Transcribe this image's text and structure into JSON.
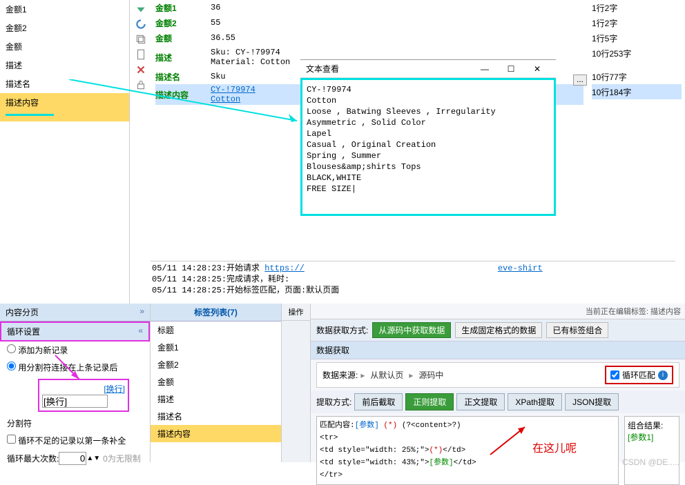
{
  "left_items": [
    "金额1",
    "金额2",
    "金额",
    "描述",
    "描述名",
    "描述内容"
  ],
  "left_selected_index": 5,
  "middle_rows": [
    {
      "label": "金额1",
      "val": "36",
      "stat": "1行2字"
    },
    {
      "label": "金额2",
      "val": "55",
      "stat": "1行2字"
    },
    {
      "label": "金额",
      "val": "36.55",
      "stat": "1行5字"
    },
    {
      "label": "描述",
      "val": "Sku: CY-!79974\nMaterial: Cotton",
      "stat": "10行253字"
    },
    {
      "label": "描述名",
      "val": "Sku",
      "stat": "10行77字"
    },
    {
      "label": "描述内容",
      "val": "CY-!79974\nCotton",
      "stat": "10行184字",
      "highlight": true
    }
  ],
  "popup": {
    "title": "文本查看",
    "body": "CY-!79974\nCotton\nLoose , Batwing Sleeves , Irregularity\nAsymmetric , Solid Color\nLapel\nCasual , Original Creation\nSpring , Summer\nBlouses&amp;shirts Tops\nBLACK,WHITE\nFREE SIZE|"
  },
  "logs": [
    {
      "t": "05/11 14:28:23:开始请求 ",
      "link": "https://",
      "tail": "eve-shirt"
    },
    {
      "t": "05/11 14:28:25:完成请求，耗时:"
    },
    {
      "t": "05/11 14:28:25:开始标签匹配，页面:默认页面"
    }
  ],
  "bl": {
    "hdr1": "内容分页",
    "hdr2": "循环设置",
    "radio1": "添加为新记录",
    "radio2": "用分割符连接在上条记录后",
    "swap": "[换行]",
    "sep_label": "分割符",
    "sep_value": "[换行]",
    "chk": "循环不足的记录以第一条补全",
    "maxlabel": "循环最大次数:",
    "maxval": "0",
    "maxnote": "0为无限制"
  },
  "taglist": {
    "header": "标签列表(7)",
    "items": [
      "标题",
      "金额1",
      "金额2",
      "金额",
      "描述",
      "描述名",
      "描述内容"
    ],
    "sel": 6
  },
  "ops_header": "操作",
  "rm": {
    "topnote": "当前正在编辑标签:  描述内容",
    "acq_label": "数据获取方式:",
    "btn_src": "从源码中获取数据",
    "btn_fixed": "生成固定格式的数据",
    "btn_combo": "已有标签组合",
    "acq_hdr": "数据获取",
    "src_label": "数据来源:",
    "crumb1": "从默认页",
    "crumb2": "源码中",
    "loop_match": "循环匹配",
    "ext_label": "提取方式:",
    "tabs": [
      "前后截取",
      "正则提取",
      "正文提取",
      "XPath提取",
      "JSON提取"
    ],
    "tab_active": 1,
    "match_label": "匹配内容:",
    "match_pre": "[参数] (*) (?<content>?)",
    "code": [
      "<tr>",
      "<td style=\"width: 25%;\">(*)</td>",
      "<td style=\"width: 43%;\">[参数]</td>",
      "</tr>"
    ],
    "combine_label": "组合结果:",
    "param1": "[参数1]",
    "red_note": "在这儿呢"
  },
  "watermark": "CSDN @DE....."
}
